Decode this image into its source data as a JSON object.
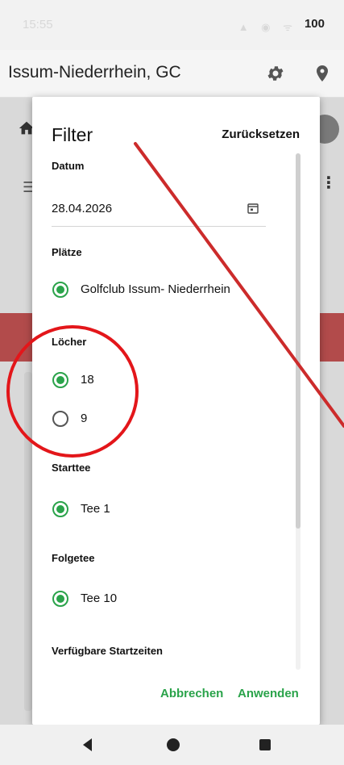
{
  "status_bar": {
    "time": "15:55",
    "icons": "▲ ◉ ᯤ",
    "battery": "100"
  },
  "app_bar": {
    "title": "Issum-Niederrhein, GC",
    "settings_icon": "gear-icon",
    "location_icon": "map-pin-icon"
  },
  "dialog": {
    "title": "Filter",
    "reset_label": "Zurücksetzen",
    "sections": {
      "date": {
        "label": "Datum",
        "value": "28.04.2026",
        "icon": "calendar-icon"
      },
      "courses": {
        "label": "Plätze",
        "options": [
          {
            "label": "Golfclub Issum- Niederrhein",
            "selected": true
          }
        ]
      },
      "holes": {
        "label": "Löcher",
        "options": [
          {
            "label": "18",
            "selected": true
          },
          {
            "label": "9",
            "selected": false
          }
        ]
      },
      "start_tee": {
        "label": "Starttee",
        "options": [
          {
            "label": "Tee 1",
            "selected": true
          }
        ]
      },
      "follow_tee": {
        "label": "Folgetee",
        "options": [
          {
            "label": "Tee 10",
            "selected": true
          }
        ]
      },
      "times": {
        "label": "Verfügbare Startzeiten"
      }
    },
    "actions": {
      "cancel": "Abbrechen",
      "apply": "Anwenden"
    },
    "scroll_position": 0
  },
  "colors": {
    "accent": "#2aa34a",
    "annotation": "#e3161a",
    "line": "#cc2b2b"
  }
}
